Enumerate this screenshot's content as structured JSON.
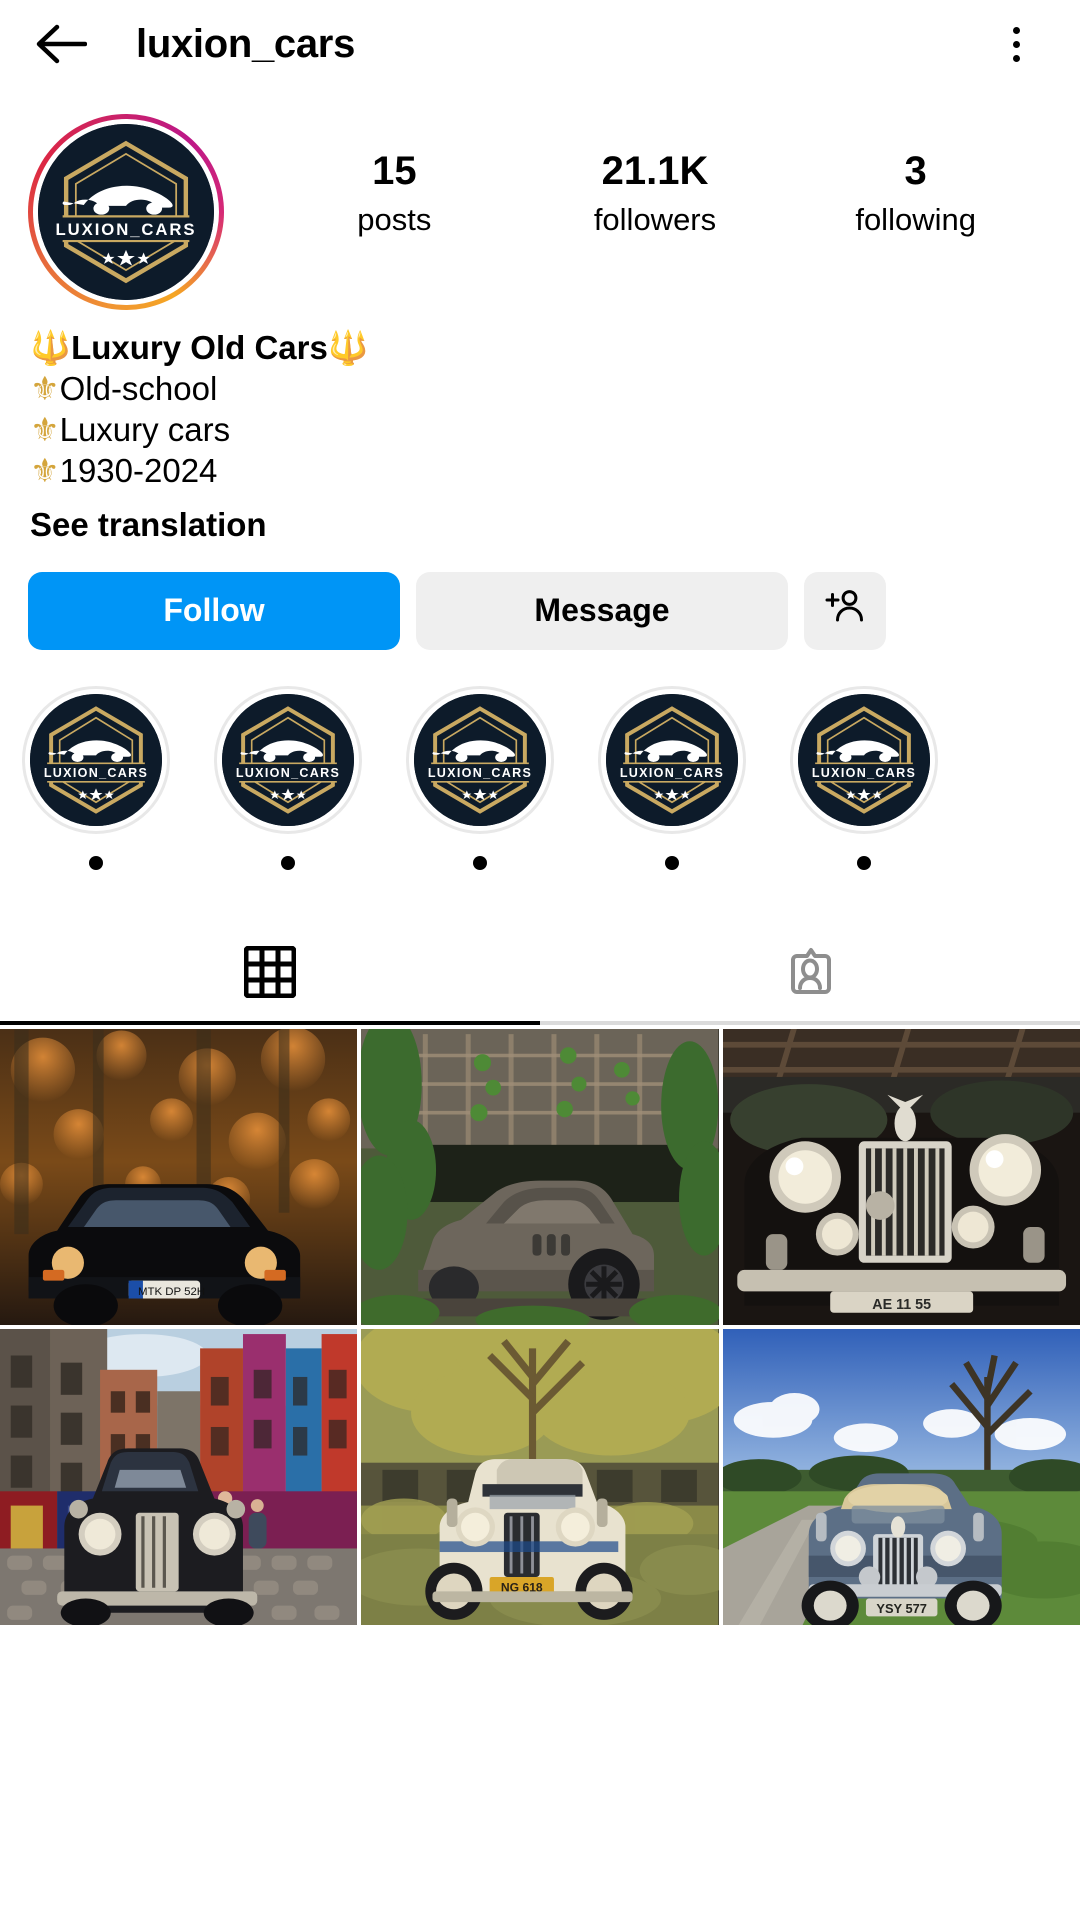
{
  "header": {
    "back_icon": "back-arrow-icon",
    "title": "luxion_cars",
    "menu_icon": "kebab-menu-icon"
  },
  "profile": {
    "avatar_name": "LUXION_CARS",
    "avatar_alt": "luxion-cars-logo",
    "has_story_ring": true,
    "stats": [
      {
        "value": "15",
        "label": "posts",
        "name": "posts"
      },
      {
        "value": "21.1K",
        "label": "followers",
        "name": "followers"
      },
      {
        "value": "3",
        "label": "following",
        "name": "following"
      }
    ],
    "bio": {
      "lines": [
        {
          "emoji_before": "🔱",
          "text": "Luxury Old Cars",
          "emoji_after": "🔱",
          "bold": true
        },
        {
          "emoji_before": "⚜",
          "text": "Old-school",
          "emoji_after": "",
          "bold": false
        },
        {
          "emoji_before": "⚜",
          "text": "Luxury cars",
          "emoji_after": "",
          "bold": false
        },
        {
          "emoji_before": "⚜",
          "text": "1930-2024",
          "emoji_after": "",
          "bold": false
        }
      ],
      "see_translation": "See translation"
    },
    "actions": {
      "follow_label": "Follow",
      "message_label": "Message",
      "add_person_icon": "add-person-icon"
    }
  },
  "highlights": [
    {
      "name": "highlight-1",
      "label": "·"
    },
    {
      "name": "highlight-2",
      "label": "·"
    },
    {
      "name": "highlight-3",
      "label": "·"
    },
    {
      "name": "highlight-4",
      "label": "·"
    },
    {
      "name": "highlight-5",
      "label": "·"
    }
  ],
  "tabs": [
    {
      "name": "tab-posts-grid",
      "icon": "grid-icon",
      "active": true
    },
    {
      "name": "tab-tagged",
      "icon": "tagged-person-icon",
      "active": false
    }
  ],
  "grid_posts": [
    {
      "name": "post-porsche-911-forest",
      "alt": "Black Porsche 911 in autumn forest",
      "plate": "MTK DP 52H"
    },
    {
      "name": "post-dusty-pagani-shed",
      "alt": "Dusty Pagani Huayra under tiled shed with ivy",
      "plate": ""
    },
    {
      "name": "post-rolls-royce-chrome-grille",
      "alt": "Black Rolls-Royce with chrome grille in garage",
      "plate": "AE 11 55"
    },
    {
      "name": "post-vintage-car-cobbled-street",
      "alt": "Vintage black car on colorful cobbled Edinburgh street",
      "plate": ""
    },
    {
      "name": "post-cream-roadster-autumn-tree",
      "alt": "Cream 1930s roadster on grass under autumn tree",
      "plate": "NG 618"
    },
    {
      "name": "post-rolls-royce-convertible-countryside",
      "alt": "Silver-blue Rolls-Royce convertible on countryside road",
      "plate": "YSY 577"
    }
  ],
  "colors": {
    "accent_blue": "#0095f6",
    "button_gray": "#efefef",
    "logo_navy": "#0d1b2a",
    "logo_gold": "#c9a961",
    "text_black": "#000000",
    "tab_inactive": "#8e8e8e"
  }
}
